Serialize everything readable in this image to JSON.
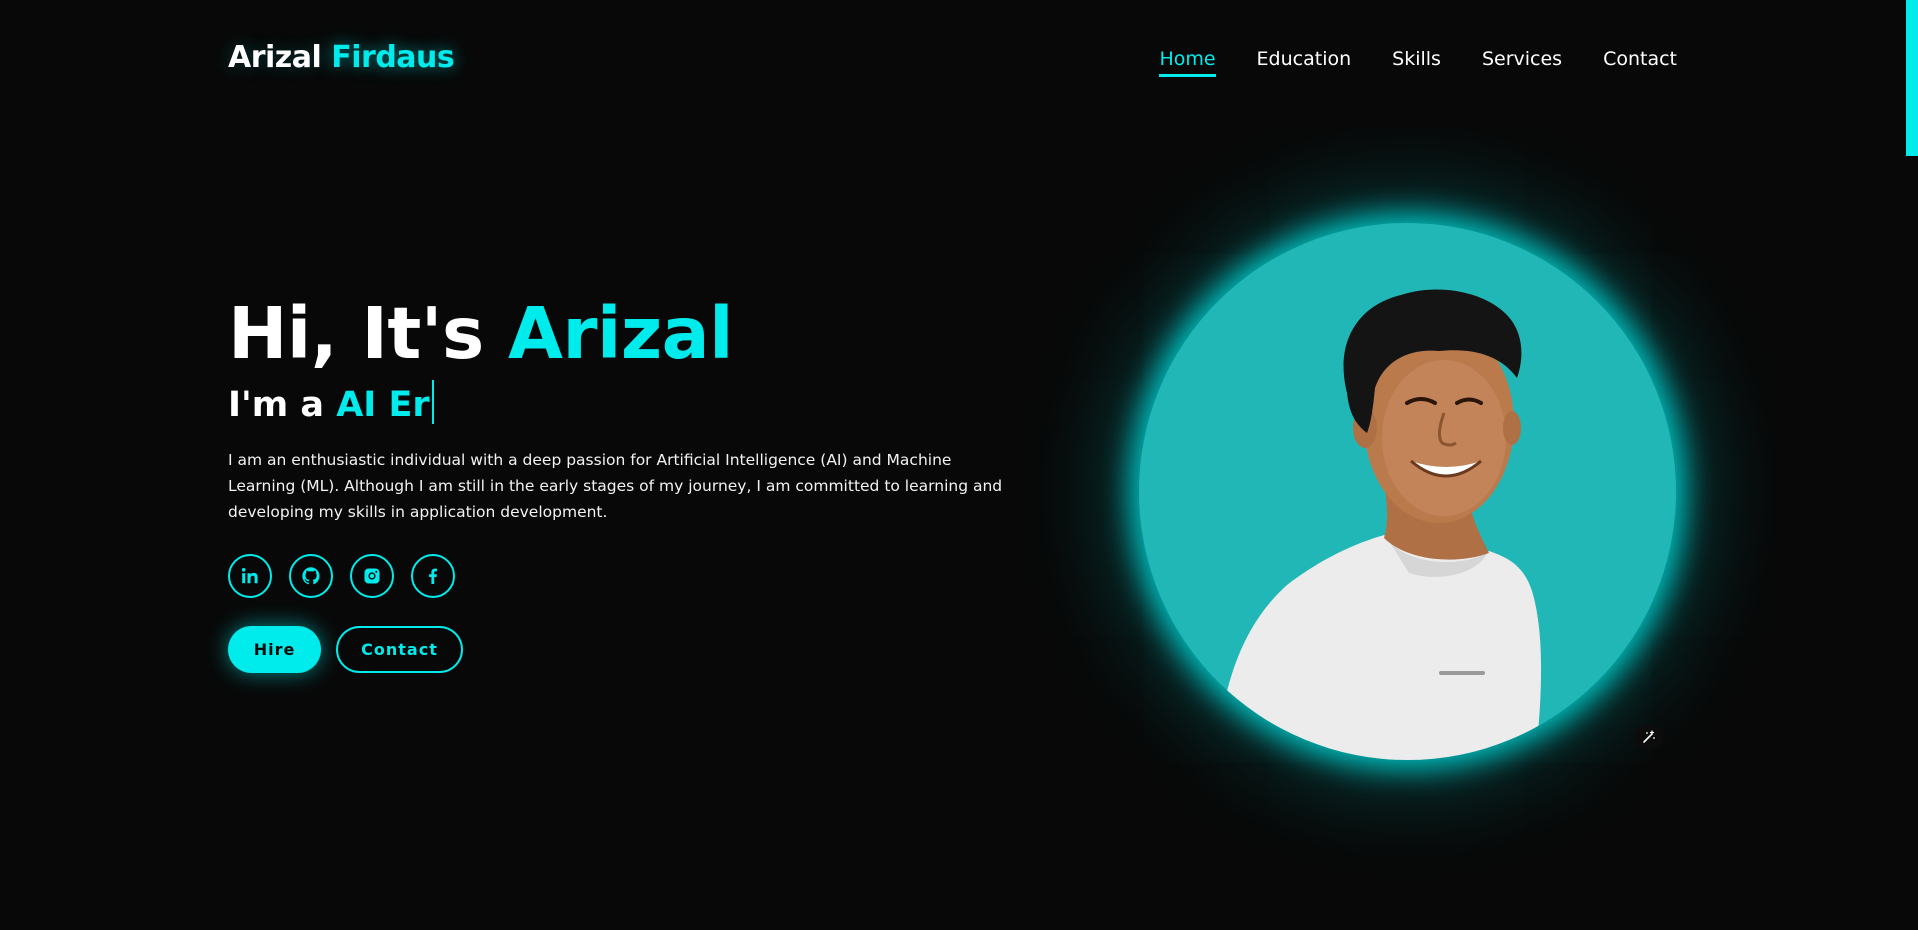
{
  "header": {
    "logo_first": "Arizal",
    "logo_last": "Firdaus",
    "nav": [
      {
        "label": "Home",
        "active": true
      },
      {
        "label": "Education",
        "active": false
      },
      {
        "label": "Skills",
        "active": false
      },
      {
        "label": "Services",
        "active": false
      },
      {
        "label": "Contact",
        "active": false
      }
    ]
  },
  "hero": {
    "greeting": "Hi, It's ",
    "name": "Arizal",
    "role_prefix": "I'm a ",
    "role_typed": "AI Er",
    "description": "I am an enthusiastic individual with a deep passion for Artificial Intelligence (AI) and Machine Learning (ML). Although I am still in the early stages of my journey, I am committed to learning and developing my skills in application development.",
    "socials": [
      "linkedin-icon",
      "github-icon",
      "instagram-icon",
      "facebook-icon"
    ],
    "buttons": {
      "hire": "Hire",
      "contact": "Contact"
    }
  },
  "colors": {
    "background": "#080808",
    "accent": "#00ecec",
    "profile_bg": "#22b7b7",
    "text": "#ffffff"
  }
}
